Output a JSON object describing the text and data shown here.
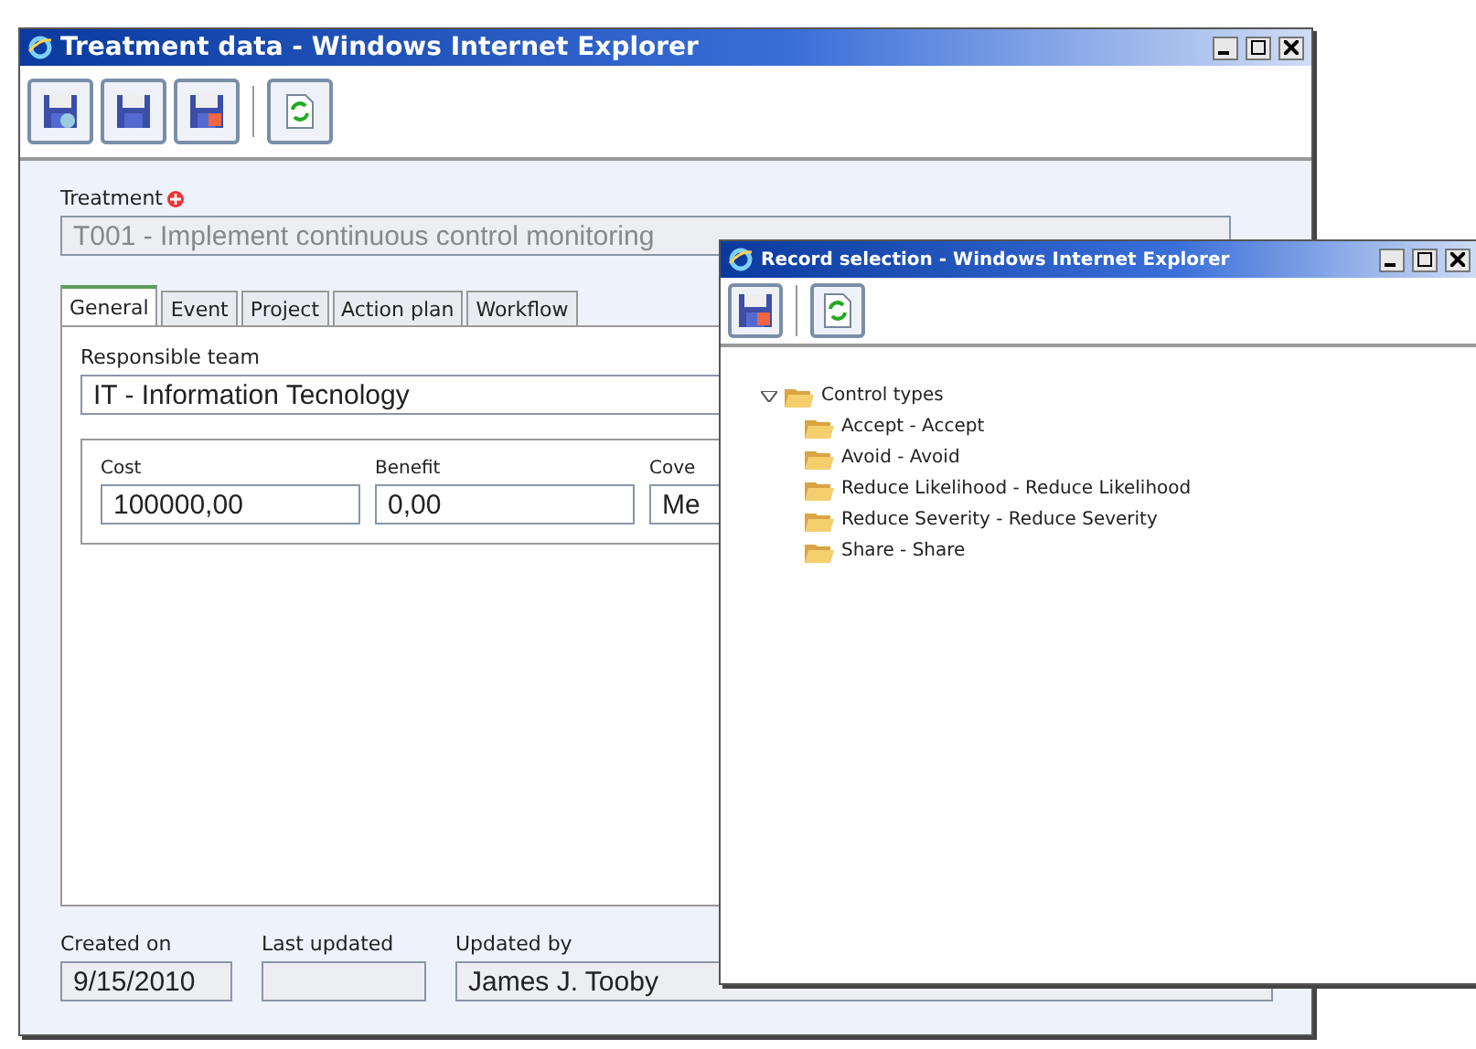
{
  "main_window": {
    "title": "Treatment data - Windows Internet Explorer",
    "toolbar": [
      {
        "kind": "save-new"
      },
      {
        "kind": "save"
      },
      {
        "kind": "save-close"
      },
      {
        "kind": "refresh"
      }
    ],
    "treatment": {
      "label": "Treatment",
      "required": true,
      "disabled": true,
      "value": "T001 - Implement continuous control monitoring"
    },
    "tabs": [
      {
        "label": "General",
        "selected": true
      },
      {
        "label": "Event",
        "selected": false
      },
      {
        "label": "Project",
        "selected": false
      },
      {
        "label": "Action plan",
        "selected": false
      },
      {
        "label": "Workflow",
        "selected": false
      }
    ],
    "responsible_team": {
      "label": "Responsible team",
      "value": "IT - Information Tecnology"
    },
    "costs": [
      {
        "label": "Cost",
        "value": "100000,00"
      },
      {
        "label": "Benefit",
        "value": "0,00"
      },
      {
        "label": "Cove",
        "value": "Me"
      }
    ],
    "footer": [
      {
        "label": "Created on",
        "value": "9/15/2010"
      },
      {
        "label": "Last updated"
      },
      {
        "label": "Updated by",
        "value": "James J. Tooby"
      }
    ]
  },
  "popup_window": {
    "title": "Record selection - Windows Internet Explorer",
    "toolbar": [
      {
        "kind": "save-close"
      },
      {
        "kind": "refresh"
      }
    ],
    "tree": [
      {
        "label": "Control types",
        "expanded": true,
        "children": [
          {
            "label": "Accept - Accept"
          },
          {
            "label": "Avoid - Avoid"
          },
          {
            "label": "Reduce Likelihood - Reduce Likelihood"
          },
          {
            "label": "Reduce Severity - Reduce Severity"
          },
          {
            "label": "Share - Share"
          }
        ]
      }
    ]
  }
}
